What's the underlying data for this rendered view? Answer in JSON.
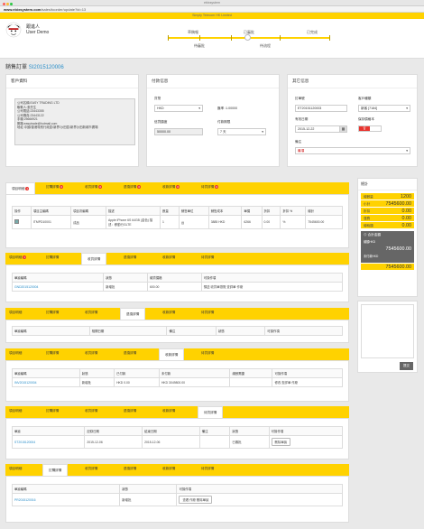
{
  "browser": {
    "title": "ebixsystem",
    "url_host": "www.ebixsystem.com",
    "url_path": "/sales/toorder/update?id=13"
  },
  "brand": "Simply Telecom HK Limited",
  "user": {
    "name": "跟進人",
    "role": "User Demo"
  },
  "progress": {
    "top_steps": [
      "草稿報",
      "已審批",
      "已完成"
    ],
    "bottom_steps": [
      "待審批",
      "待流程"
    ],
    "current_step": "已審批"
  },
  "page_title": {
    "label": "銷售訂單",
    "id": "SI2015120006"
  },
  "customer": {
    "heading": "客戶資料",
    "address_lines": [
      "公司名稱:EASY TRADING LTD",
      "聯繫人:張先生",
      "公司電話:23443355",
      "公司傳真:23443122",
      "手機:25666921",
      "郵箱:easytrade@hotmail.com",
      "地址:中國/香港特別行政區/新界/沙田區/新界沙田新城市廣場"
    ]
  },
  "payment": {
    "heading": "付款信息",
    "currency_label": "貨幣",
    "currency_value": "HKD",
    "rate_label": "匯率 :1.00000",
    "credit_label": "信貸額度",
    "credit_value": "50000.00",
    "terms_label": "付款期限",
    "terms_value": "7 天"
  },
  "other": {
    "heading": "其它信息",
    "order_no_label": "訂單號",
    "order_no_value": "ET20151120003",
    "customer_group_label": "客戶種類",
    "customer_group_value": "新客 [7184]",
    "date_label": "有效日期",
    "date_value": "2015-12-22",
    "tax_label": "保存價格本",
    "toggle_value": "否",
    "remark_label": "備注",
    "remark_value": "最項"
  },
  "tabs_main": [
    "項目明細",
    "訂購詳情",
    "收貨詳情",
    "退換詳情",
    "收款詳情",
    "待貨詳情"
  ],
  "tabs_badges": [
    "1",
    "0",
    "0",
    "0",
    "0",
    "0"
  ],
  "items_table": {
    "headers": [
      "操作",
      "項目主編碼",
      "項目次編碼",
      "描述",
      "數量",
      "銷售單位",
      "銷售成本",
      "單價",
      "折扣",
      "折扣 %",
      "總計"
    ],
    "rows": [
      [
        "",
        "ITMPD10001",
        "成品",
        "Apple iPhone 6S 64GB (金色) 描述：移動行GLTE",
        "1",
        "台",
        "3885 HKD",
        "6266",
        "0.00",
        "%",
        "7545600.00"
      ]
    ]
  },
  "tabs_receive": [
    "項目明細",
    "訂購詳情",
    "收貨詳情",
    "退換詳情",
    "收款詳情",
    "待貨詳情"
  ],
  "receive_table": {
    "headers": [
      "單據編碼",
      "狀態",
      "總貨價格",
      "可操作項"
    ],
    "rows": [
      [
        "GND2015120004",
        "新增批",
        "600.00",
        "預送  收貨單瀏覽  查詳單  作廢"
      ]
    ]
  },
  "tabs_return": [
    "項目明細",
    "訂購詳情",
    "收貨詳情",
    "退換詳情",
    "收款詳情",
    "待貨詳情"
  ],
  "return_table": {
    "headers": [
      "單據編碼",
      "相關日期",
      "備注",
      "狀態",
      "可操作項"
    ],
    "rows": []
  },
  "tabs_invoice": [
    "項目明細",
    "訂購詳情",
    "收貨詳情",
    "退換詳情",
    "收款詳情",
    "待貨詳情"
  ],
  "invoice_table": {
    "headers": [
      "單據編碼",
      "狀態",
      "已付款",
      "未付款",
      "總數需捷",
      "可操作項"
    ],
    "rows": [
      [
        "INV2015120004",
        "新增批",
        "HKD 0.00",
        "HKD 3049800.00",
        "",
        "修改  查詳單  作廢"
      ]
    ]
  },
  "tabs_pending": [
    "項目明細",
    "訂購詳情",
    "收貨詳情",
    "退換詳情",
    "收款詳情",
    "待貨詳情"
  ],
  "pending_table": {
    "headers": [
      "單據",
      "記錄日期",
      "結束日期",
      "備注",
      "狀態",
      "可操作項"
    ],
    "rows": [
      [
        "ST2015120004",
        "2015-12-06",
        "2015-12-06",
        "",
        "已審批",
        "刪除單據"
      ]
    ]
  },
  "tabs_order": [
    "項目明細",
    "訂購詳情",
    "收貨詳情",
    "退換詳情",
    "收款詳情",
    "待貨詳情"
  ],
  "order_table": {
    "headers": [
      "單據編碼",
      "狀態",
      "可操作項"
    ],
    "rows": [
      [
        "PR2015120016",
        "新增批",
        "查看  作廢  刪除單據"
      ]
    ]
  },
  "summary": {
    "heading": "總計",
    "rows": [
      {
        "label": "總數量",
        "value": "1200"
      },
      {
        "label": "小計",
        "value": "7545600.00"
      },
      {
        "label": "折扣",
        "value": "0.00"
      },
      {
        "label": "運費",
        "value": "0.00"
      },
      {
        "label": "總稅額",
        "value": "0.00"
      }
    ],
    "total_label": "⊙ 合計金額",
    "total_hkd_label": "總額HKD",
    "total_value": "7545600.00",
    "net_label": "未付款HKD",
    "net_value": "7545600.00",
    "submit": "提交"
  },
  "colors": {
    "accent": "#ffd200",
    "link": "#2a8ec9",
    "badge": "#e8352f"
  }
}
